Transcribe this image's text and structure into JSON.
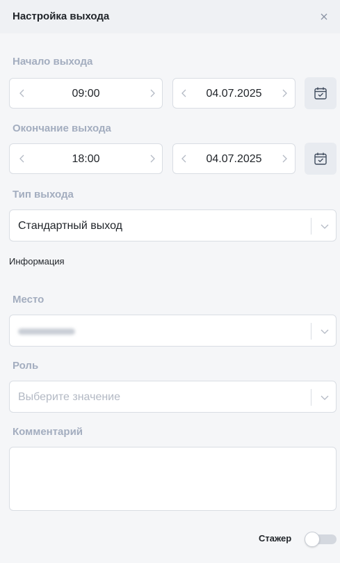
{
  "header": {
    "title": "Настройка выхода"
  },
  "start": {
    "label": "Начало выхода",
    "time": "09:00",
    "date": "04.07.2025"
  },
  "end": {
    "label": "Окончание выхода",
    "time": "18:00",
    "date": "04.07.2025"
  },
  "shift_type": {
    "label": "Тип выхода",
    "value": "Стандартный выход"
  },
  "info": {
    "label": "Информация"
  },
  "place": {
    "label": "Место"
  },
  "role": {
    "label": "Роль",
    "placeholder": "Выберите значение"
  },
  "comment": {
    "label": "Комментарий",
    "value": ""
  },
  "trainee": {
    "label": "Стажер",
    "enabled": false
  },
  "colors": {
    "label_gray": "#a3adbf",
    "header_bg": "#eff1f4",
    "page_bg": "#f5f6f8",
    "border": "#d9dde3"
  }
}
